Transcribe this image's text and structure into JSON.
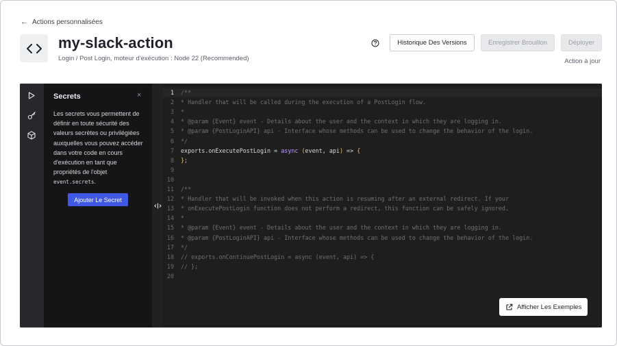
{
  "breadcrumb": {
    "back_label": "Actions personnalisées"
  },
  "header": {
    "title": "my-slack-action",
    "subtitle": "Login / Post Login, moteur d'exécution : Node 22 (Recommended)",
    "icon": "code-brackets-icon",
    "help_icon": "question-circle-icon",
    "history_label": "Historique Des Versions",
    "save_draft_label": "Enregistrer Brouillon",
    "deploy_label": "Déployer",
    "status": "Action à jour"
  },
  "rail": {
    "icons": [
      "play-icon",
      "key-icon",
      "package-icon"
    ]
  },
  "secrets": {
    "title": "Secrets",
    "close": "×",
    "description": "Les secrets vous permettent de définir en toute sécurité des valeurs secrètes ou privilégiées auxquelles vous pouvez accéder dans votre code en cours d'exécution en tant que propriétés de l'objet",
    "code_ref": "event.secrets",
    "code_ref_suffix": ".",
    "add_label": "Ajouter Le Secret"
  },
  "code": {
    "active_line": 1,
    "lines": [
      {
        "n": "1",
        "text": "/**",
        "kind": "comment"
      },
      {
        "n": "2",
        "text": "* Handler that will be called during the execution of a PostLogin flow.",
        "kind": "comment"
      },
      {
        "n": "3",
        "text": "*",
        "kind": "comment"
      },
      {
        "n": "4",
        "text": "* @param {Event} event - Details about the user and the context in which they are logging in.",
        "kind": "comment"
      },
      {
        "n": "5",
        "text": "* @param {PostLoginAPI} api - Interface whose methods can be used to change the behavior of the login.",
        "kind": "comment"
      },
      {
        "n": "6",
        "text": "*/",
        "kind": "comment"
      },
      {
        "n": "7",
        "text": "exports.onExecutePostLogin = async (event, api) => {",
        "kind": "code7"
      },
      {
        "n": "8",
        "text": "};",
        "kind": "paren"
      },
      {
        "n": "9",
        "text": "",
        "kind": "plain"
      },
      {
        "n": "10",
        "text": "",
        "kind": "plain"
      },
      {
        "n": "11",
        "text": "/**",
        "kind": "comment"
      },
      {
        "n": "12",
        "text": "* Handler that will be invoked when this action is resuming after an external redirect. If your",
        "kind": "comment"
      },
      {
        "n": "13",
        "text": "* onExecutePostLogin function does not perform a redirect, this function can be safely ignored.",
        "kind": "comment"
      },
      {
        "n": "14",
        "text": "*",
        "kind": "comment"
      },
      {
        "n": "15",
        "text": "* @param {Event} event - Details about the user and the context in which they are logging in.",
        "kind": "comment"
      },
      {
        "n": "16",
        "text": "* @param {PostLoginAPI} api - Interface whose methods can be used to change the behavior of the login.",
        "kind": "comment"
      },
      {
        "n": "17",
        "text": "*/",
        "kind": "comment"
      },
      {
        "n": "18",
        "text": "// exports.onContinuePostLogin = async (event, api) => {",
        "kind": "comment"
      },
      {
        "n": "19",
        "text": "// };",
        "kind": "comment"
      },
      {
        "n": "20",
        "text": "",
        "kind": "plain"
      }
    ]
  },
  "examples": {
    "label": "Afficher Les Exemples",
    "icon": "external-link-icon"
  },
  "colors": {
    "primary_button": "#3f59e4",
    "editor_bg": "#1e1e1f",
    "panel_bg": "#151517"
  }
}
